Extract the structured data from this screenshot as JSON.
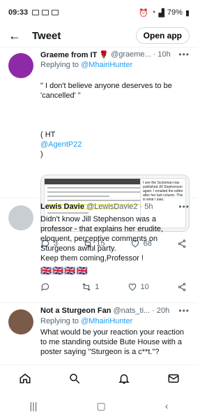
{
  "status_bar": {
    "time": "09:33",
    "battery": "79%"
  },
  "header": {
    "title": "Tweet",
    "open_app": "Open app"
  },
  "tweets": [
    {
      "name": "Graeme from IT 🌹",
      "handle": "@graeme...",
      "time": "· 10h",
      "reply_prefix": "Replying to",
      "reply_to": "@MhairiHunter",
      "text_1": "\" I don't believe anyone deserves to be 'cancelled' \"",
      "text_2": "( HT",
      "text_link": "@AgentP22",
      "text_3": ")",
      "embed_side_text": "I see the Scotsman has published Jill Stephenson again. I emailed the editor after her last column. This is what I said.",
      "replies": "3",
      "retweets": "15",
      "likes": "68"
    },
    {
      "name": "Lewis Davie",
      "handle": "@LewisDavie2",
      "time": "· 5h",
      "text": "Didn't know Jill Stephenson was a professor - that explains her erudite, eloquent,  perceptive comments on Sturgeons awful party.\nKeep them coming,Professor !",
      "flags": "🇬🇧🇬🇧🇬🇧🇬🇧",
      "replies": "",
      "retweets": "1",
      "likes": "10"
    },
    {
      "name": "Not a Sturgeon Fan",
      "handle": "@nats_ti...",
      "time": "· 20h",
      "reply_prefix": "Replying to",
      "reply_to": "@MhairiHunter",
      "text": "What would be your reaction your reaction to me standing outside Bute House with a poster saying \"Sturgeon is a c**t.\"?"
    }
  ],
  "icons": [
    "back-arrow-icon",
    "more-icon",
    "reply-icon",
    "retweet-icon",
    "like-icon",
    "share-icon",
    "home-icon",
    "search-icon",
    "notifications-icon",
    "messages-icon"
  ]
}
